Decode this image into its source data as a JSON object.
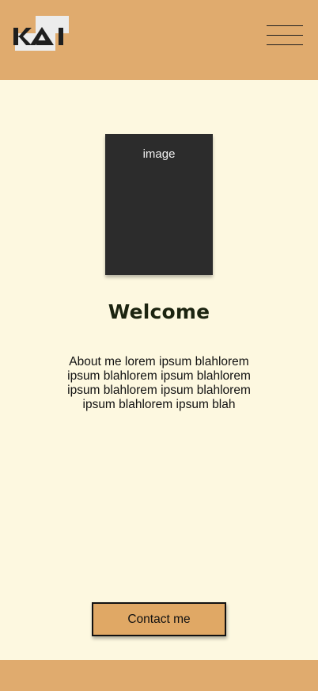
{
  "header": {
    "logo_text": "KAI",
    "menu_icon": "hamburger-menu-icon"
  },
  "hero": {
    "image_label": "image",
    "title": "Welcome",
    "about": "About me lorem ipsum blahlorem ipsum blahlorem ipsum blahlorem ipsum blahlorem ipsum blahlorem ipsum blahlorem ipsum blah"
  },
  "cta": {
    "contact_label": "Contact me"
  },
  "colors": {
    "background": "#fdf8e0",
    "header": "#e0ab6e",
    "button": "#e0a865",
    "image_placeholder": "#2c2c2c",
    "text_dark": "#1c2410"
  }
}
